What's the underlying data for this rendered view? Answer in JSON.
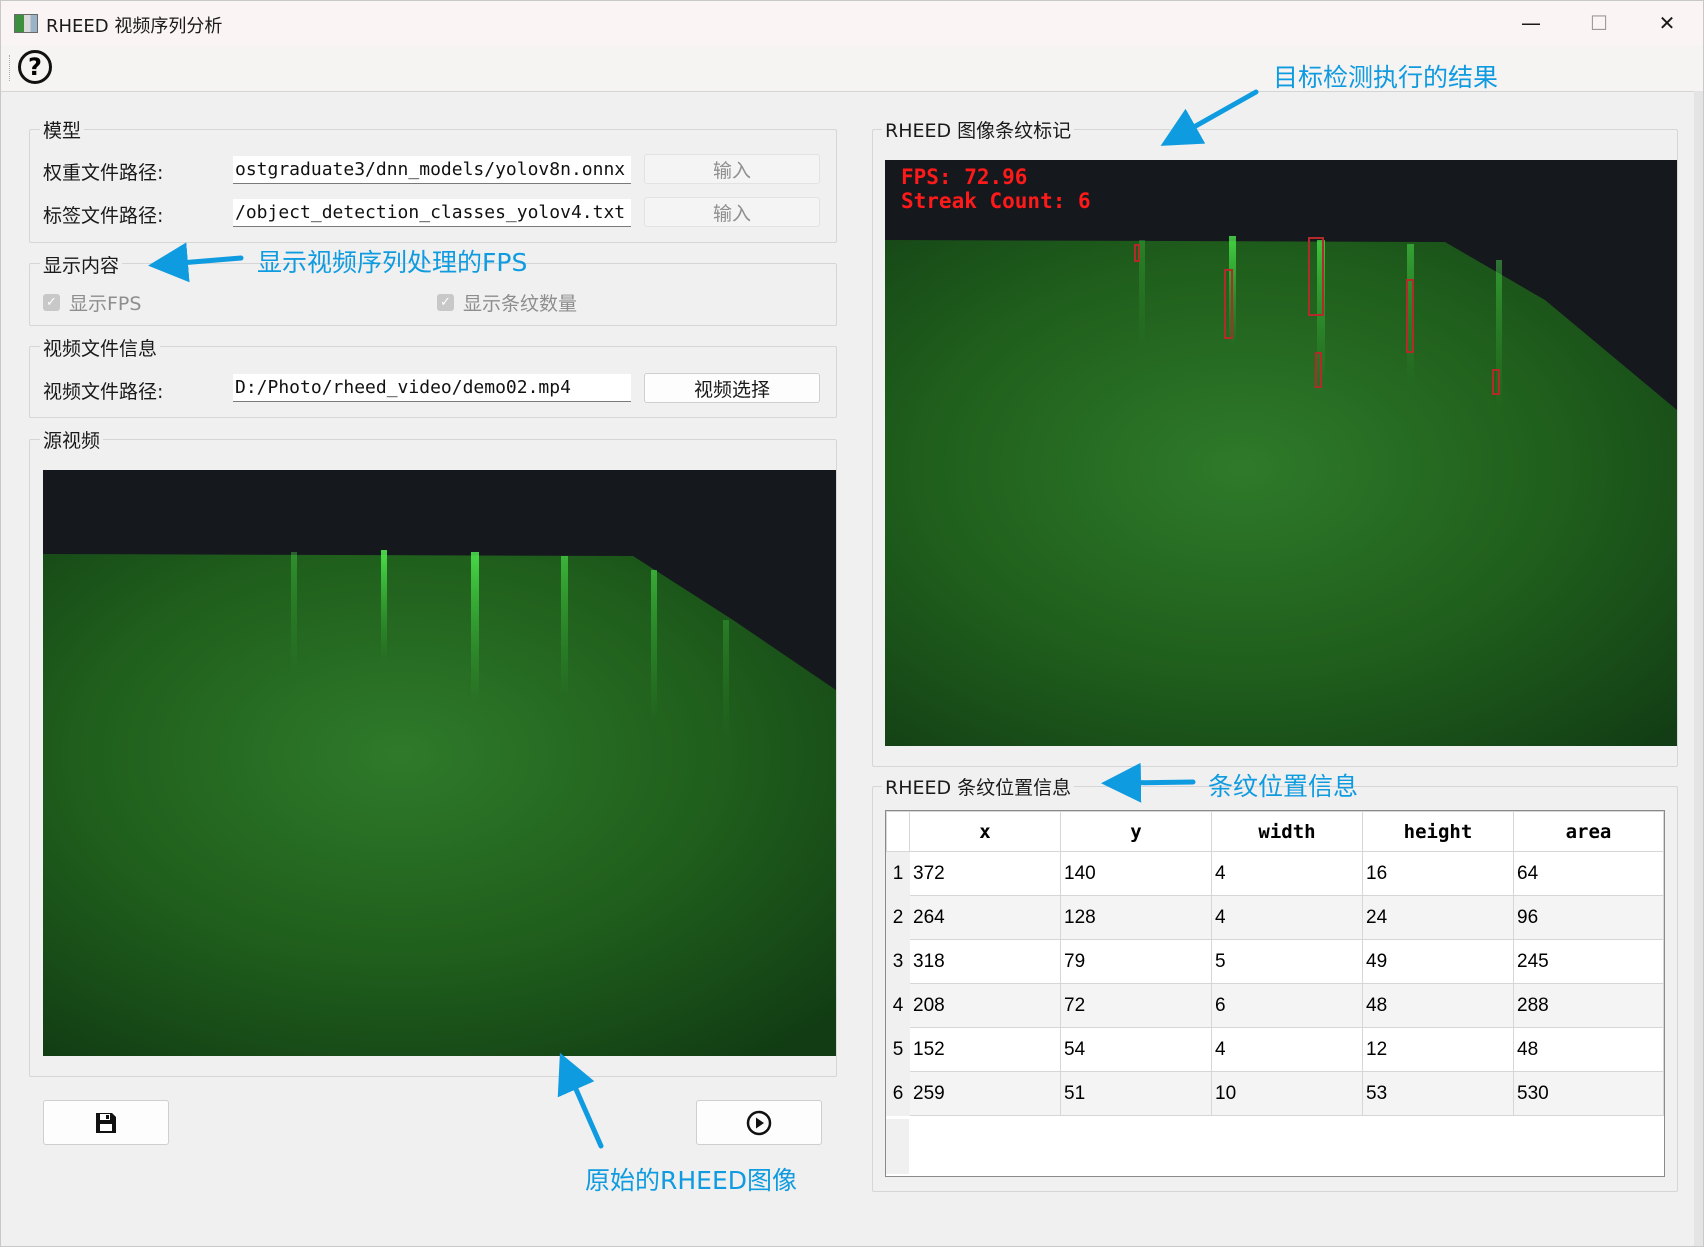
{
  "window": {
    "title": "RHEED 视频序列分析",
    "minimize": "—",
    "maximize": "☐",
    "close": "✕"
  },
  "toolbar": {
    "help_glyph": "?"
  },
  "model": {
    "group_title": "模型",
    "weight_label": "权重文件路径:",
    "weight_value": "ostgraduate3/dnn_models/yolov8n.onnx",
    "weight_button": "输入",
    "label_label": "标签文件路径:",
    "label_value": "/object_detection_classes_yolov4.txt",
    "label_button": "输入"
  },
  "display": {
    "group_title": "显示内容",
    "show_fps": "显示FPS",
    "show_count": "显示条纹数量"
  },
  "video_info": {
    "group_title": "视频文件信息",
    "path_label": "视频文件路径:",
    "path_value": "D:/Photo/rheed_video/demo02.mp4",
    "select_button": "视频选择"
  },
  "source": {
    "group_title": "源视频"
  },
  "marked": {
    "group_title": "RHEED 图像条纹标记",
    "fps_text": "FPS: 72.96",
    "count_text": "Streak Count: 6"
  },
  "positions": {
    "group_title": "RHEED 条纹位置信息",
    "columns": [
      "x",
      "y",
      "width",
      "height",
      "area"
    ],
    "rows": [
      {
        "n": "1",
        "x": "372",
        "y": "140",
        "width": "4",
        "height": "16",
        "area": "64"
      },
      {
        "n": "2",
        "x": "264",
        "y": "128",
        "width": "4",
        "height": "24",
        "area": "96"
      },
      {
        "n": "3",
        "x": "318",
        "y": "79",
        "width": "5",
        "height": "49",
        "area": "245"
      },
      {
        "n": "4",
        "x": "208",
        "y": "72",
        "width": "6",
        "height": "48",
        "area": "288"
      },
      {
        "n": "5",
        "x": "152",
        "y": "54",
        "width": "4",
        "height": "12",
        "area": "48"
      },
      {
        "n": "6",
        "x": "259",
        "y": "51",
        "width": "10",
        "height": "53",
        "area": "530"
      }
    ]
  },
  "annotations": {
    "detection_result": "目标检测执行的结果",
    "fps_note": "显示视频序列处理的FPS",
    "position_note": "条纹位置信息",
    "original_image": "原始的RHEED图像"
  },
  "icons": {
    "save": "save-icon",
    "play": "play-icon",
    "help": "help-icon"
  },
  "colors": {
    "accent_annotation": "#0f9be0",
    "overlay_text": "#ff1a1a",
    "streak_green": "#2bd42b"
  }
}
